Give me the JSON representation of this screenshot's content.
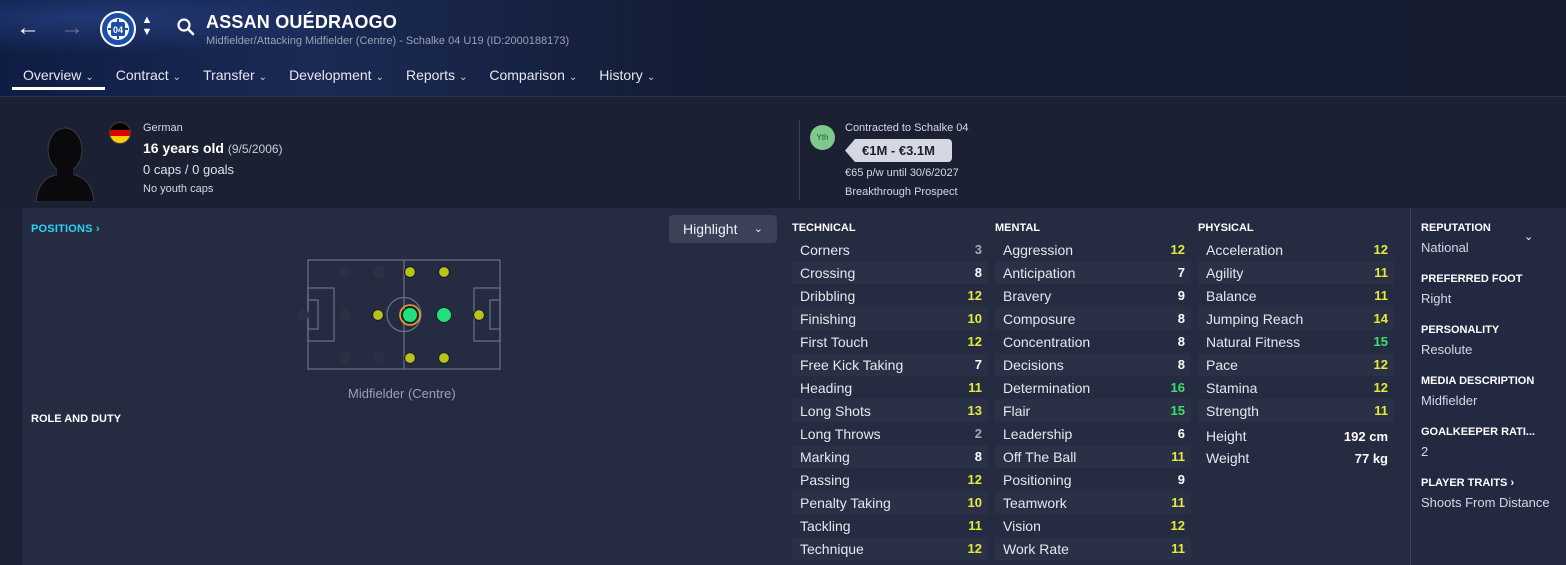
{
  "header": {
    "name": "ASSAN OUÉDRAOGO",
    "subtitle": "Midfielder/Attacking Midfielder (Centre) - Schalke 04 U19 (ID:2000188173)",
    "back_icon": "arrow-left-icon",
    "forward_icon": "arrow-right-icon",
    "club_badge_text": "04",
    "tabs": [
      {
        "label": "Overview"
      },
      {
        "label": "Contract"
      },
      {
        "label": "Transfer"
      },
      {
        "label": "Development"
      },
      {
        "label": "Reports"
      },
      {
        "label": "Comparison"
      },
      {
        "label": "History"
      }
    ]
  },
  "bio": {
    "nationality": "German",
    "age": "16 years old",
    "dob": "(9/5/2006)",
    "caps": "0 caps / 0 goals",
    "youth_caps": "No youth caps",
    "flag_colors": [
      "#000000",
      "#dd0000",
      "#ffce00"
    ]
  },
  "contract": {
    "badge": "Yth",
    "contracted_to": "Contracted to Schalke 04",
    "value": "€1M - €3.1M",
    "wage": "€65 p/w until 30/6/2027",
    "status": "Breakthrough Prospect"
  },
  "positions": {
    "link": "POSITIONS",
    "highlight_label": "Highlight",
    "caption": "Midfielder (Centre)",
    "role_duty": "ROLE AND DUTY"
  },
  "technical": {
    "heading": "TECHNICAL",
    "rows": [
      {
        "label": "Corners",
        "value": "3",
        "tier": "c-low"
      },
      {
        "label": "Crossing",
        "value": "8",
        "tier": "c-mid"
      },
      {
        "label": "Dribbling",
        "value": "12",
        "tier": "c-good"
      },
      {
        "label": "Finishing",
        "value": "10",
        "tier": "c-good"
      },
      {
        "label": "First Touch",
        "value": "12",
        "tier": "c-good"
      },
      {
        "label": "Free Kick Taking",
        "value": "7",
        "tier": "c-mid"
      },
      {
        "label": "Heading",
        "value": "11",
        "tier": "c-good"
      },
      {
        "label": "Long Shots",
        "value": "13",
        "tier": "c-good"
      },
      {
        "label": "Long Throws",
        "value": "2",
        "tier": "c-low"
      },
      {
        "label": "Marking",
        "value": "8",
        "tier": "c-mid"
      },
      {
        "label": "Passing",
        "value": "12",
        "tier": "c-good"
      },
      {
        "label": "Penalty Taking",
        "value": "10",
        "tier": "c-good"
      },
      {
        "label": "Tackling",
        "value": "11",
        "tier": "c-good"
      },
      {
        "label": "Technique",
        "value": "12",
        "tier": "c-good"
      }
    ]
  },
  "mental": {
    "heading": "MENTAL",
    "rows": [
      {
        "label": "Aggression",
        "value": "12",
        "tier": "c-good"
      },
      {
        "label": "Anticipation",
        "value": "7",
        "tier": "c-mid"
      },
      {
        "label": "Bravery",
        "value": "9",
        "tier": "c-mid"
      },
      {
        "label": "Composure",
        "value": "8",
        "tier": "c-mid"
      },
      {
        "label": "Concentration",
        "value": "8",
        "tier": "c-mid"
      },
      {
        "label": "Decisions",
        "value": "8",
        "tier": "c-mid"
      },
      {
        "label": "Determination",
        "value": "16",
        "tier": "c-high"
      },
      {
        "label": "Flair",
        "value": "15",
        "tier": "c-high"
      },
      {
        "label": "Leadership",
        "value": "6",
        "tier": "c-mid"
      },
      {
        "label": "Off The Ball",
        "value": "11",
        "tier": "c-good"
      },
      {
        "label": "Positioning",
        "value": "9",
        "tier": "c-mid"
      },
      {
        "label": "Teamwork",
        "value": "11",
        "tier": "c-good"
      },
      {
        "label": "Vision",
        "value": "12",
        "tier": "c-good"
      },
      {
        "label": "Work Rate",
        "value": "11",
        "tier": "c-good"
      }
    ]
  },
  "physical": {
    "heading": "PHYSICAL",
    "rows": [
      {
        "label": "Acceleration",
        "value": "12",
        "tier": "c-good"
      },
      {
        "label": "Agility",
        "value": "11",
        "tier": "c-good"
      },
      {
        "label": "Balance",
        "value": "11",
        "tier": "c-good"
      },
      {
        "label": "Jumping Reach",
        "value": "14",
        "tier": "c-good"
      },
      {
        "label": "Natural Fitness",
        "value": "15",
        "tier": "c-high"
      },
      {
        "label": "Pace",
        "value": "12",
        "tier": "c-good"
      },
      {
        "label": "Stamina",
        "value": "12",
        "tier": "c-good"
      },
      {
        "label": "Strength",
        "value": "11",
        "tier": "c-good"
      }
    ],
    "height_label": "Height",
    "height": "192 cm",
    "weight_label": "Weight",
    "weight": "77 kg"
  },
  "info": {
    "reputation_label": "REPUTATION",
    "reputation": "National",
    "foot_label": "PREFERRED FOOT",
    "foot": "Right",
    "personality_label": "PERSONALITY",
    "personality": "Resolute",
    "media_label": "MEDIA DESCRIPTION",
    "media": "Midfielder",
    "gk_label": "GOALKEEPER RATI...",
    "gk": "2",
    "traits_label": "PLAYER TRAITS",
    "traits": "Shoots From Distance"
  },
  "colors": {
    "accent": "#2bd4f5",
    "rating_good": "#e3ea3a",
    "rating_high": "#3fe06a",
    "natural_position": "#21e07a",
    "secondary_position": "#b8c21a"
  }
}
